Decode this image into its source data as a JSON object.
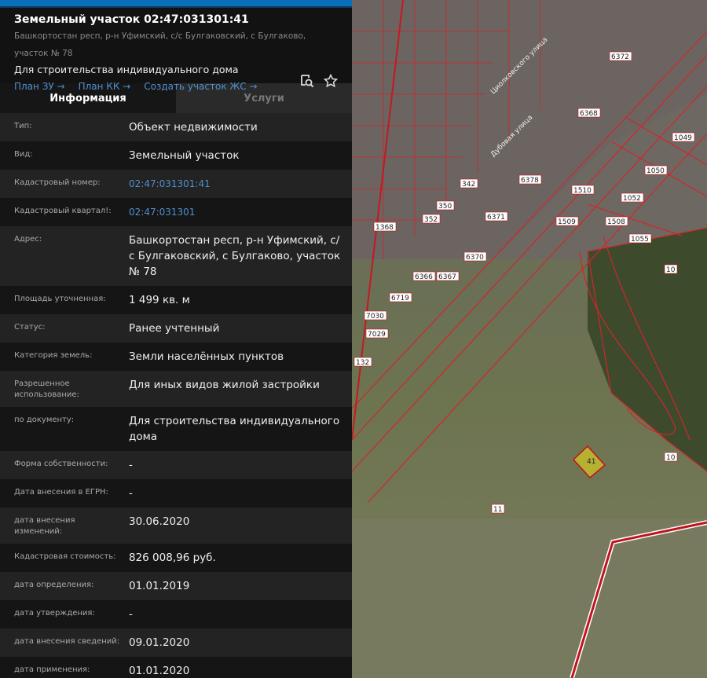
{
  "header": {
    "title": "Земельный участок 02:47:031301:41",
    "address": "Башкортостан респ, р-н Уфимский, с/с Булгаковский, с Булгаково, участок № 78",
    "purpose": "Для строительства индивидуального дома",
    "links": [
      "План ЗУ →",
      "План КК →",
      "Создать участок ЖС →"
    ],
    "icons": [
      "search-map-icon",
      "star-icon"
    ]
  },
  "tabs": [
    "Информация",
    "Услуги"
  ],
  "rows": [
    {
      "label": "Тип:",
      "value": "Объект недвижимости"
    },
    {
      "label": "Вид:",
      "value": "Земельный участок"
    },
    {
      "label": "Кадастровый номер:",
      "value": "02:47:031301:41",
      "link": true
    },
    {
      "label": "Кадастровый квартал!:",
      "value": "02:47:031301",
      "link": true
    },
    {
      "label": "Адрес:",
      "value": "Башкортостан респ, р-н Уфимский, с/с Булгаковский, с Булгаково, участок № 78"
    },
    {
      "label": "Площадь уточненная:",
      "value": "1 499 кв. м"
    },
    {
      "label": "Статус:",
      "value": "Ранее учтенный"
    },
    {
      "label": "Категория земель:",
      "value": "Земли населённых пунктов"
    },
    {
      "label": "Разрешенное использование:",
      "value": "Для иных видов жилой застройки"
    },
    {
      "label": "по документу:",
      "value": "Для строительства индивидуального дома"
    },
    {
      "label": "Форма собственности:",
      "value": "-"
    },
    {
      "label": "Дата внесения в ЕГРН:",
      "value": "-"
    },
    {
      "label": "дата внесения изменений:",
      "value": "30.06.2020"
    },
    {
      "label": "Кадастровая стоимость:",
      "value": "826 008,96 руб."
    },
    {
      "label": "дата определения:",
      "value": "01.01.2019"
    },
    {
      "label": "дата утверждения:",
      "value": "-"
    },
    {
      "label": "дата внесения сведений:",
      "value": "09.01.2020"
    },
    {
      "label": "дата применения:",
      "value": "01.01.2020"
    }
  ],
  "map": {
    "labels": [
      "6372",
      "6368",
      "1049",
      "1050",
      "1052",
      "1510",
      "1509",
      "1508",
      "1055",
      "6378",
      "6371",
      "6370",
      "6367",
      "6366",
      "6719",
      "7030",
      "7029",
      "132",
      "1368",
      "352",
      "350",
      "342",
      "10",
      "10",
      "11",
      "41",
      "Дубовая улица",
      "Циолковского улица"
    ]
  }
}
